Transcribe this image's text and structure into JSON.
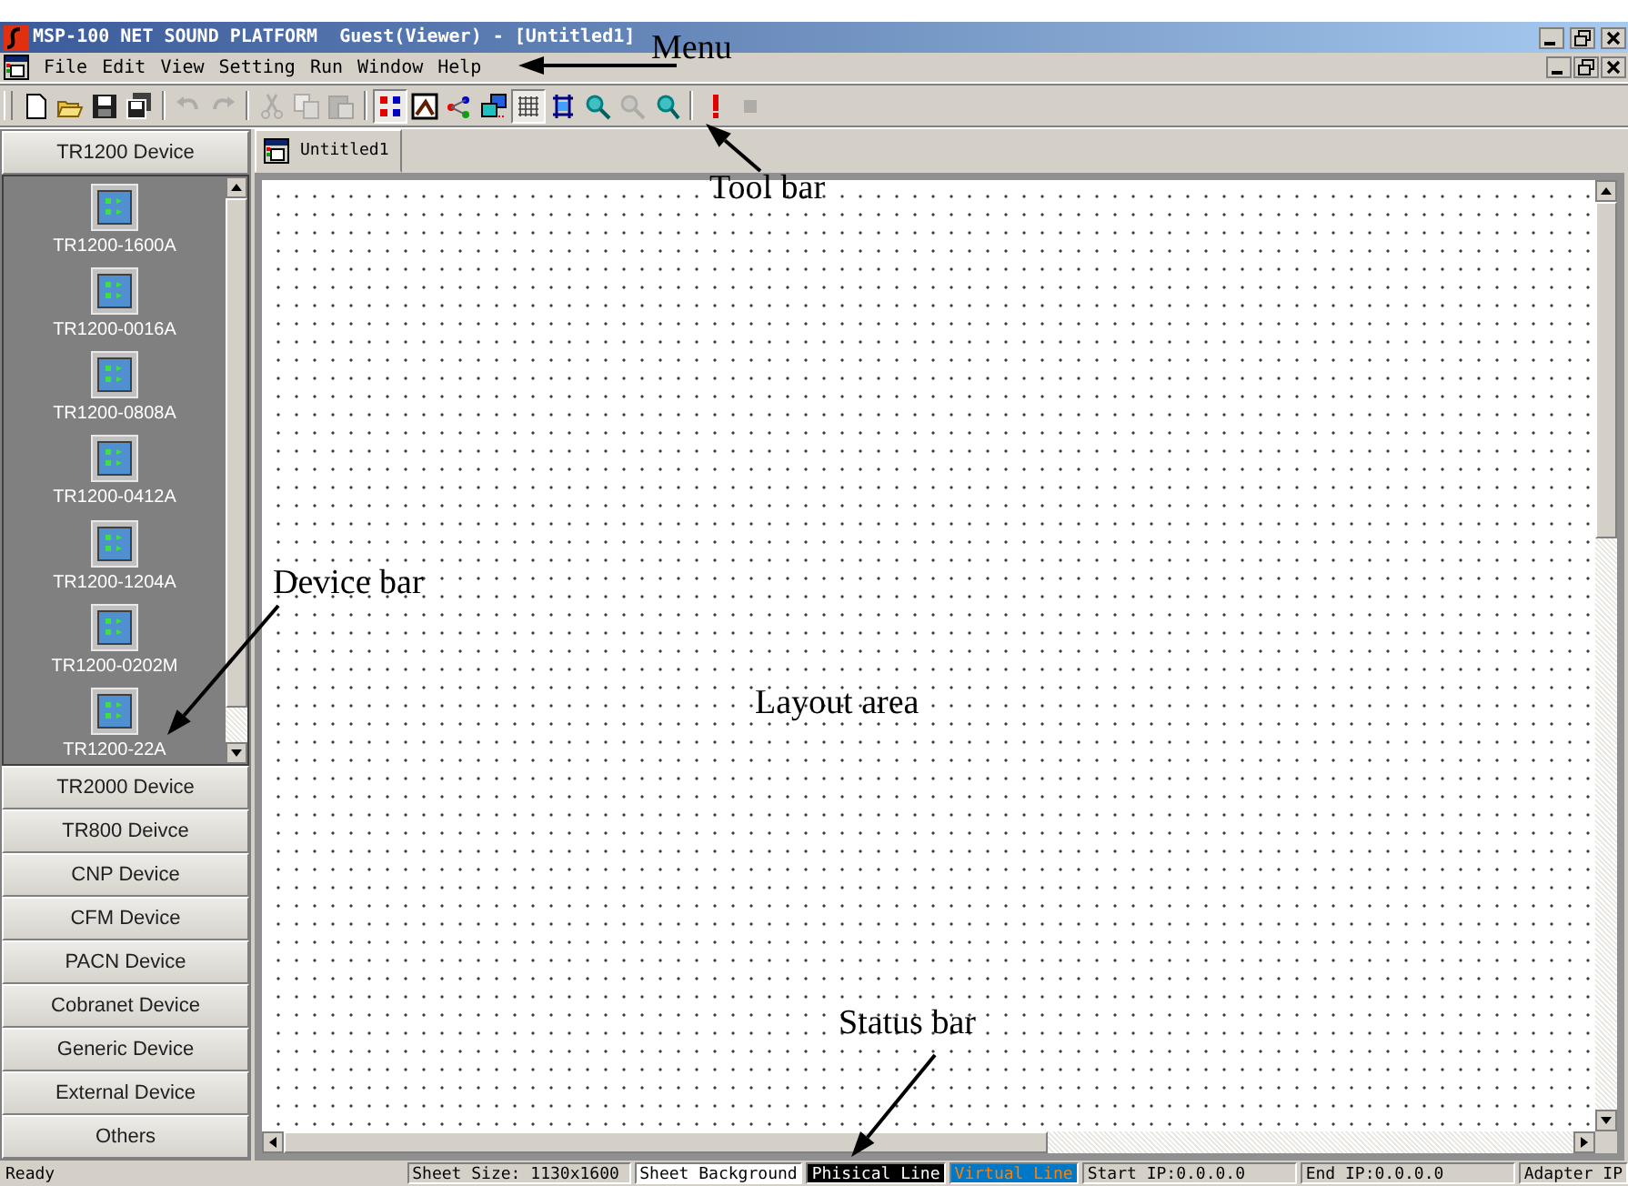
{
  "window": {
    "title": "MSP-100 NET SOUND PLATFORM  Guest(Viewer) - [Untitled1]"
  },
  "menu": [
    "File",
    "Edit",
    "View",
    "Setting",
    "Run",
    "Window",
    "Help"
  ],
  "toolbar": [
    {
      "kind": "button",
      "pressed": false,
      "disabled": false
    },
    {
      "kind": "button",
      "pressed": false,
      "disabled": false
    },
    {
      "kind": "button",
      "pressed": false,
      "disabled": false
    },
    {
      "kind": "button",
      "pressed": false,
      "disabled": false
    },
    {
      "kind": "separator"
    },
    {
      "kind": "button",
      "pressed": false,
      "disabled": true
    },
    {
      "kind": "button",
      "pressed": false,
      "disabled": true
    },
    {
      "kind": "separator"
    },
    {
      "kind": "button",
      "pressed": false,
      "disabled": true
    },
    {
      "kind": "button",
      "pressed": false,
      "disabled": true
    },
    {
      "kind": "button",
      "pressed": false,
      "disabled": true
    },
    {
      "kind": "separator"
    },
    {
      "kind": "button",
      "pressed": true,
      "disabled": false
    },
    {
      "kind": "button",
      "pressed": false,
      "disabled": false
    },
    {
      "kind": "button",
      "pressed": false,
      "disabled": false
    },
    {
      "kind": "button",
      "pressed": false,
      "disabled": false
    },
    {
      "kind": "button",
      "pressed": true,
      "disabled": false
    },
    {
      "kind": "button",
      "pressed": false,
      "disabled": false
    },
    {
      "kind": "button",
      "pressed": false,
      "disabled": false
    },
    {
      "kind": "button",
      "pressed": false,
      "disabled": true
    },
    {
      "kind": "button",
      "pressed": false,
      "disabled": false
    },
    {
      "kind": "separator"
    },
    {
      "kind": "button",
      "pressed": false,
      "disabled": false
    },
    {
      "kind": "button",
      "pressed": false,
      "disabled": true
    }
  ],
  "device_sections": [
    {
      "label": "TR1200 Device",
      "devices": [
        "TR1200-1600A",
        "TR1200-0016A",
        "TR1200-0808A",
        "TR1200-0412A",
        "TR1200-1204A",
        "TR1200-0202M",
        "TR1200-22A"
      ]
    },
    {
      "label": "TR2000 Device"
    },
    {
      "label": "TR800 Deivce"
    },
    {
      "label": "CNP Device"
    },
    {
      "label": "CFM Device"
    },
    {
      "label": "PACN Device"
    },
    {
      "label": "Cobranet Device"
    },
    {
      "label": "Generic Device"
    },
    {
      "label": "External Device"
    },
    {
      "label": "Others"
    }
  ],
  "document_tabs": [
    {
      "label": "Untitled1"
    }
  ],
  "status_bar": [
    {
      "text": "Ready",
      "kind": "message"
    },
    {
      "text": "Sheet Size: 1130x1600",
      "kind": "plain"
    },
    {
      "text": "Sheet Background",
      "kind": "light"
    },
    {
      "text": "Phisical Line",
      "kind": "dark"
    },
    {
      "text": "Virtual Line",
      "kind": "highlight"
    },
    {
      "text": "Start IP:0.0.0.0",
      "kind": "plain"
    },
    {
      "text": "End IP:0.0.0.0",
      "kind": "plain"
    },
    {
      "text": "Adapter IP",
      "kind": "plain"
    }
  ],
  "annotations": [
    {
      "text": "Menu",
      "arrow": true
    },
    {
      "text": "Tool bar",
      "arrow": true
    },
    {
      "text": "Device bar",
      "arrow": true
    },
    {
      "text": "Layout area",
      "arrow": false
    },
    {
      "text": "Status bar",
      "arrow": true
    }
  ]
}
